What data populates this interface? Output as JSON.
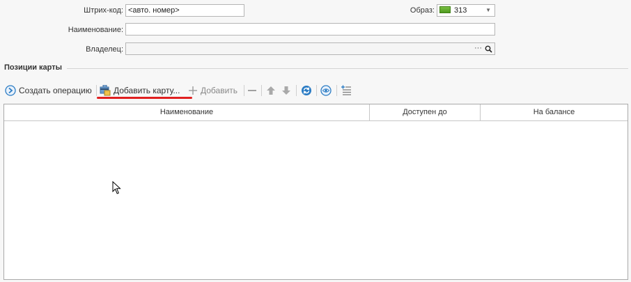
{
  "form": {
    "barcode_label": "Штрих-код:",
    "barcode_value": "<авто. номер>",
    "image_label": "Образ:",
    "image_value": "313",
    "name_label": "Наименование:",
    "name_value": "",
    "owner_label": "Владелец:",
    "owner_value": "",
    "owner_dots": "···"
  },
  "section": {
    "title": "Позиции карты"
  },
  "toolbar": {
    "create_operation": "Создать операцию",
    "add_card": "Добавить карту...",
    "add": "Добавить"
  },
  "grid": {
    "columns": [
      "Наименование",
      "Доступен до",
      "На балансе"
    ]
  },
  "colors": {
    "highlight_underline": "#e02020",
    "card_green": "#5fae2e",
    "icon_blue": "#2b7cc4"
  }
}
